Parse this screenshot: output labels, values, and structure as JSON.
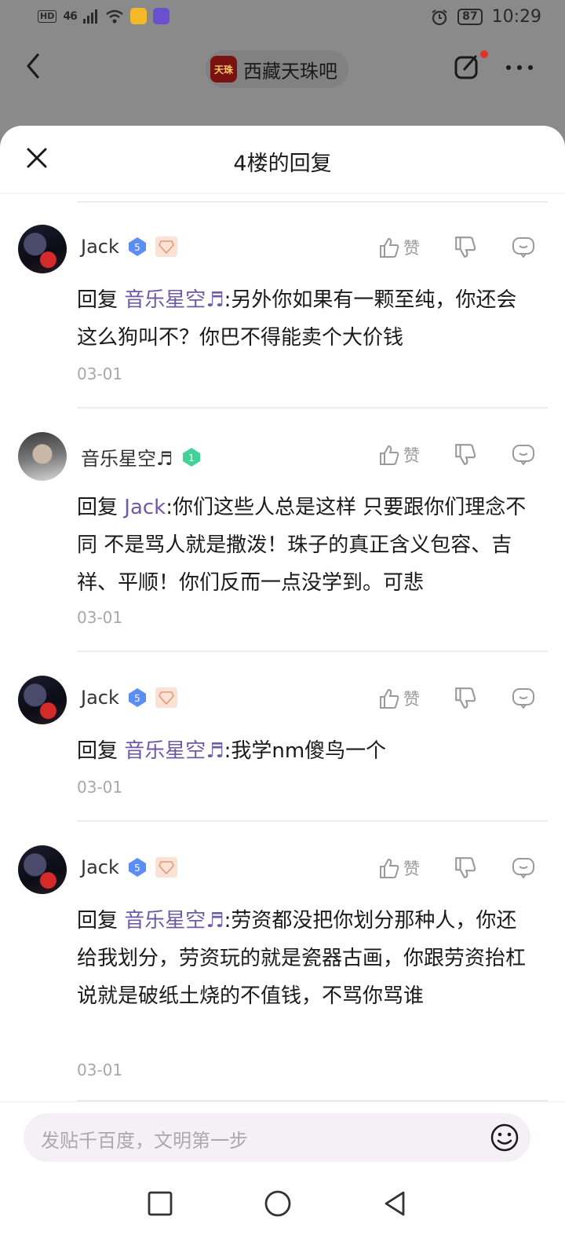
{
  "status": {
    "network": "HD",
    "signal": "46",
    "battery": "87",
    "time": "10:29",
    "app_icon_1_color": "#f5b829",
    "app_icon_2_color": "#6a4fd0"
  },
  "header": {
    "back_icon": "chevron-left-icon",
    "forum_logo_text": "天珠",
    "forum_name": "西藏天珠吧",
    "edit_icon": "edit-icon",
    "more_icon": "more-icon"
  },
  "sheet": {
    "title": "4楼的回复",
    "close_icon": "close-icon"
  },
  "replies": [
    {
      "user": "Jack",
      "level": "5",
      "reply_prefix": "回复",
      "reply_to": "音乐星空♬",
      "text": ":另外你如果有一颗至纯，你还会这么狗叫不？你巴不得能卖个大价钱",
      "like_label": "赞",
      "date": "03-01"
    },
    {
      "user": "音乐星空♬",
      "level": "1",
      "reply_prefix": "回复",
      "reply_to": "Jack",
      "text": ":你们这些人总是这样 只要跟你们理念不同 不是骂人就是撒泼！珠子的真正含义包容、吉祥、平顺！你们反而一点没学到。可悲",
      "like_label": "赞",
      "date": "03-01"
    },
    {
      "user": "Jack",
      "level": "5",
      "reply_prefix": "回复",
      "reply_to": "音乐星空♬",
      "text": ":我学nm傻鸟一个",
      "like_label": "赞",
      "date": "03-01"
    },
    {
      "user": "Jack",
      "level": "5",
      "reply_prefix": "回复",
      "reply_to": "音乐星空♬",
      "text": ":劳资都没把你划分那种人，你还给我划分，劳资玩的就是瓷器古画，你跟劳资抬杠说就是破纸土烧的不值钱，不骂你骂谁",
      "like_label": "赞",
      "date": "03-01"
    }
  ],
  "input": {
    "placeholder": "发贴千百度，文明第一步",
    "emoji_icon": "emoji-icon"
  },
  "colors": {
    "mention": "#6b5ba8",
    "level_blue": "#5b8ef5",
    "level_green": "#3fd39a"
  }
}
